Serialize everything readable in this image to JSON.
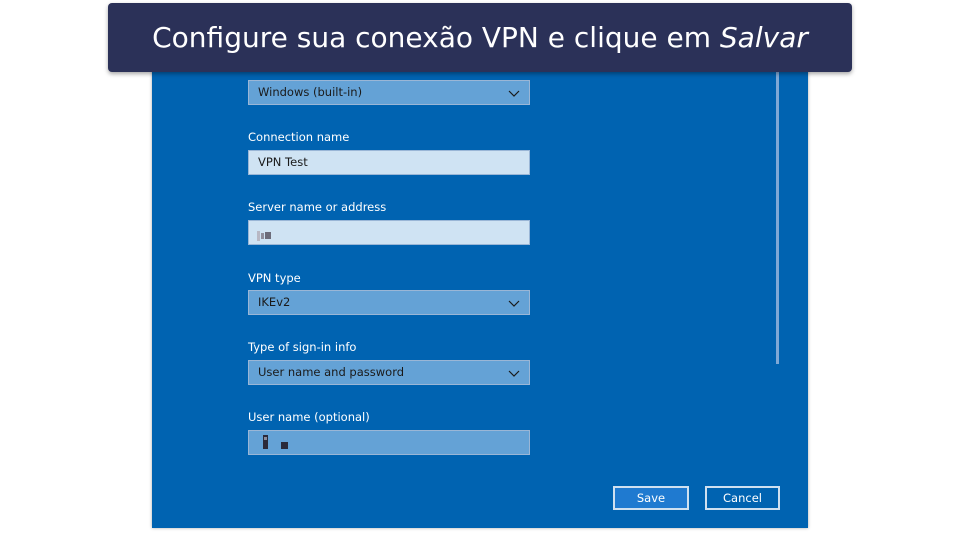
{
  "banner": {
    "text": "Configure sua conexão VPN e clique em ",
    "emphasis": "Salvar"
  },
  "form": {
    "vpn_provider": {
      "value": "Windows (built-in)"
    },
    "connection_name": {
      "label": "Connection name",
      "value": "VPN Test"
    },
    "server": {
      "label": "Server name or address"
    },
    "vpn_type": {
      "label": "VPN type",
      "value": "IKEv2"
    },
    "sign_in_type": {
      "label": "Type of sign-in info",
      "value": "User name and password"
    },
    "username": {
      "label": "User name (optional)"
    }
  },
  "buttons": {
    "save": "Save",
    "cancel": "Cancel"
  },
  "colors": {
    "dialog_bg": "#0063b1",
    "banner_bg": "#2b3158",
    "select_bg": "#64a2d6",
    "input_bg": "#cfe3f3"
  }
}
